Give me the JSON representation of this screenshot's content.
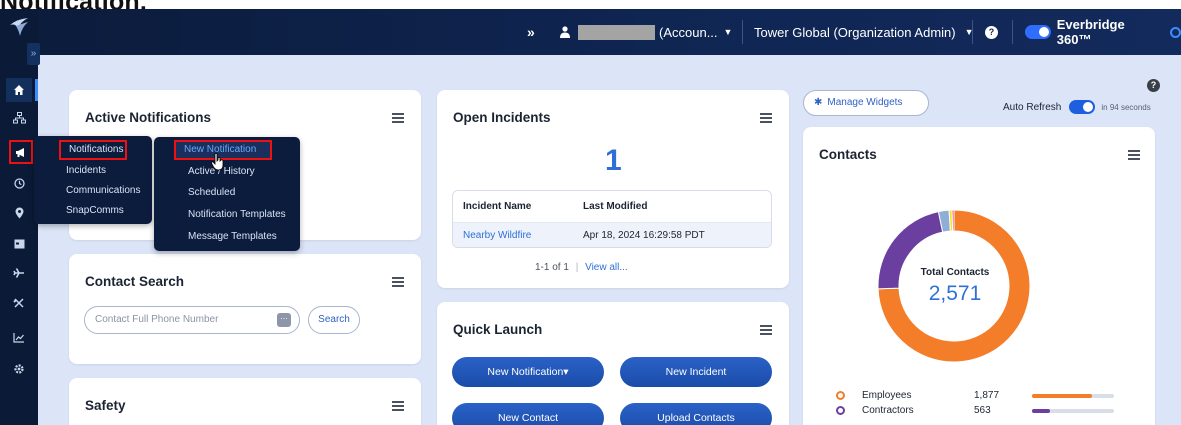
{
  "caption": "Notification.",
  "topbar": {
    "collapse_glyph": "»",
    "account_label": "(Accoun...",
    "organization_label": "Tower Global (Organization Admin)",
    "help_icon": "question-circle-icon",
    "product_label": "Everbridge 360™"
  },
  "sidebar": {
    "expand_glyph": "»",
    "icons": [
      "home-icon",
      "org-chart-icon",
      "megaphone-icon",
      "clock-icon",
      "location-pin-icon",
      "calendar-icon",
      "plane-icon",
      "crossed-tools-icon",
      "line-chart-icon",
      "settings-icon"
    ]
  },
  "flyout_primary": {
    "items": [
      "Notifications",
      "Incidents",
      "Communications",
      "SnapComms"
    ]
  },
  "flyout_secondary": {
    "items": [
      "New Notification",
      "Active / History",
      "Scheduled",
      "Notification Templates",
      "Message Templates"
    ]
  },
  "active_notifications": {
    "title": "Active Notifications"
  },
  "contact_search": {
    "title": "Contact Search",
    "placeholder": "Contact Full Phone Number",
    "button_label": "Search"
  },
  "safety": {
    "title": "Safety"
  },
  "open_incidents": {
    "title": "Open Incidents",
    "count": "1",
    "columns": [
      "Incident Name",
      "Last Modified"
    ],
    "rows": [
      {
        "name": "Nearby Wildfire",
        "modified": "Apr 18, 2024 16:29:58 PDT"
      }
    ],
    "pagination": "1-1 of 1",
    "view_all": "View all..."
  },
  "quick_launch": {
    "title": "Quick Launch",
    "buttons": [
      "New Notification▾",
      "New Incident",
      "New Contact",
      "Upload Contacts"
    ]
  },
  "widgets_bar": {
    "manage_label": "Manage Widgets",
    "auto_refresh_label": "Auto Refresh",
    "refresh_countdown": "in 94 seconds"
  },
  "contacts": {
    "title": "Contacts",
    "total_label": "Total Contacts",
    "total_value": "2,571",
    "legend": [
      {
        "label": "Employees",
        "value": "1,877",
        "color": "#f47d2a",
        "fraction": 0.73
      },
      {
        "label": "Contractors",
        "value": "563",
        "color": "#6b3fa0",
        "fraction": 0.22
      }
    ],
    "segments": [
      {
        "value": 1877,
        "color": "#f47d2a"
      },
      {
        "value": 563,
        "color": "#6b3fa0"
      },
      {
        "value": 57,
        "color": "#8eaed6"
      },
      {
        "value": 16,
        "color": "#f5e02a"
      },
      {
        "value": 10,
        "color": "#ee3344"
      }
    ]
  },
  "colors": {
    "brand_dark": "#0b1a36",
    "accent_blue": "#2e70d8",
    "highlight_red": "#ee1111"
  }
}
